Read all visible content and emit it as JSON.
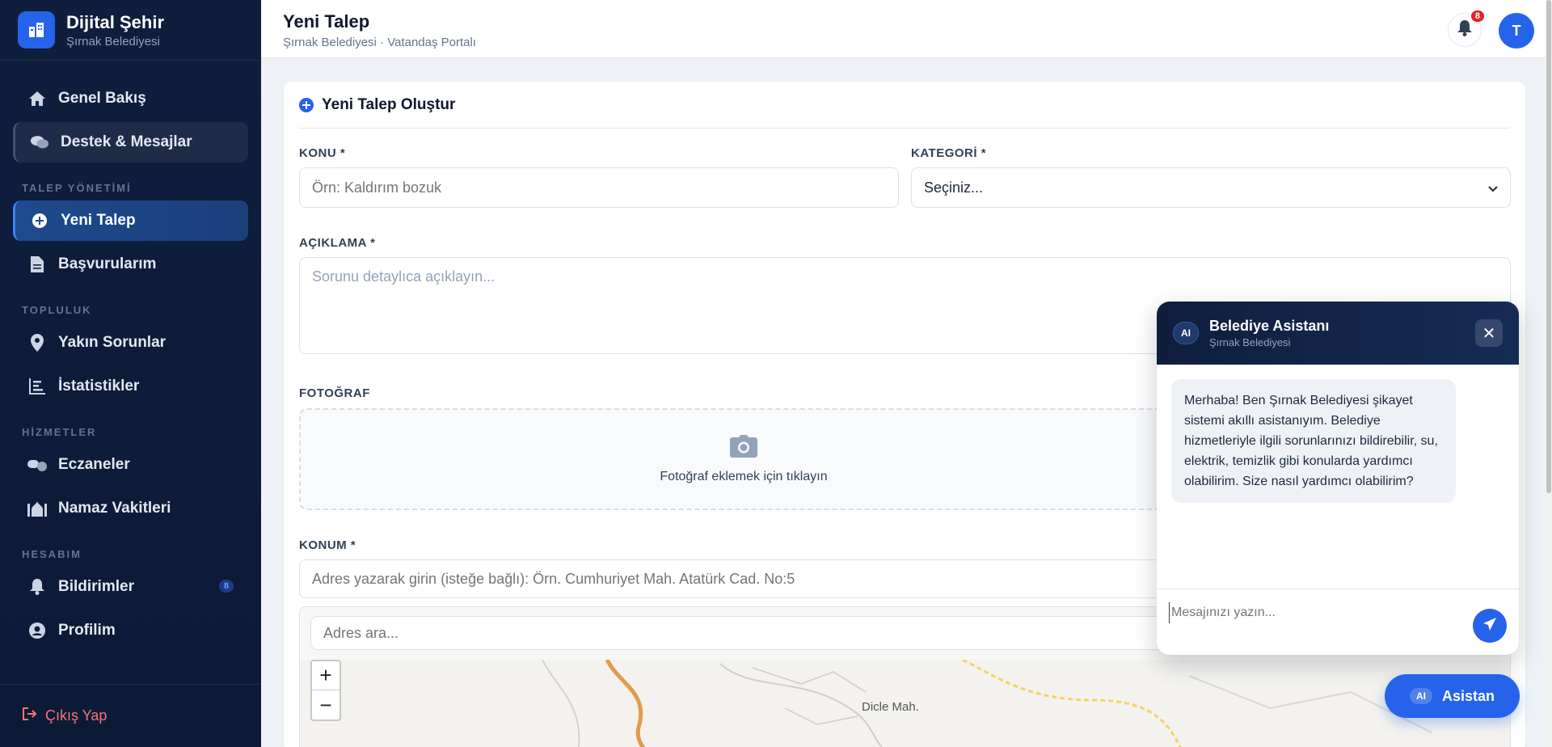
{
  "brand": {
    "title": "Dijital Şehir",
    "subtitle": "Şırnak Belediyesi"
  },
  "nav": {
    "items_top": [
      {
        "label": "Genel Bakış",
        "icon": "home-icon"
      },
      {
        "label": "Destek & Mesajlar",
        "icon": "chat-icon"
      }
    ],
    "sections": [
      {
        "label": "TALEP YÖNETİMİ",
        "items": [
          {
            "label": "Yeni Talep",
            "icon": "plus-circle-icon",
            "active": true
          },
          {
            "label": "Başvurularım",
            "icon": "document-icon"
          }
        ]
      },
      {
        "label": "TOPLULUK",
        "items": [
          {
            "label": "Yakın Sorunlar",
            "icon": "location-pin-icon"
          },
          {
            "label": "İstatistikler",
            "icon": "chart-icon"
          }
        ]
      },
      {
        "label": "HİZMETLER",
        "items": [
          {
            "label": "Eczaneler",
            "icon": "pills-icon"
          },
          {
            "label": "Namaz Vakitleri",
            "icon": "mosque-icon"
          }
        ]
      },
      {
        "label": "HESABIM",
        "items": [
          {
            "label": "Bildirimler",
            "icon": "bell-icon",
            "badge": "8"
          },
          {
            "label": "Profilim",
            "icon": "user-circle-icon"
          }
        ]
      }
    ],
    "logout_label": "Çıkış Yap"
  },
  "topbar": {
    "title": "Yeni Talep",
    "subtitle": "Şırnak Belediyesi · Vatandaş Portalı",
    "notification_count": "8",
    "avatar_initial": "T"
  },
  "form": {
    "heading": "Yeni Talep Oluştur",
    "subject": {
      "label": "KONU *",
      "placeholder": "Örn: Kaldırım bozuk"
    },
    "category": {
      "label": "KATEGORİ *",
      "selected": "Seçiniz..."
    },
    "description": {
      "label": "AÇIKLAMA *",
      "placeholder": "Sorunu detaylıca açıklayın..."
    },
    "photo": {
      "label": "FOTOĞRAF",
      "hint": "Fotoğraf eklemek için tıklayın"
    },
    "location": {
      "label": "KONUM *",
      "placeholder": "Adres yazarak girin (isteğe bağlı): Örn. Cumhuriyet Mah. Atatürk Cad. No:5",
      "search_placeholder": "Adres ara..."
    },
    "map": {
      "zoom_in": "+",
      "zoom_out": "−",
      "place_label": "Dicle Mah."
    }
  },
  "chat": {
    "badge": "AI",
    "title": "Belediye Asistanı",
    "subtitle": "Şırnak Belediyesi",
    "close": "✕",
    "message": "Merhaba! Ben Şırnak Belediyesi şikayet sistemi akıllı asistanıyım. Belediye hizmetleriyle ilgili sorunlarınızı bildirebilir, su, elektrik, temizlik gibi konularda yardımcı olabilirim. Size nasıl yardımcı olabilirim?",
    "input_placeholder": "Mesajınızı yazın..."
  },
  "fab": {
    "badge": "AI",
    "label": "Asistan"
  },
  "colors": {
    "accent": "#2563eb",
    "sidebar": "#0f1e3d",
    "danger": "#dc2626"
  }
}
